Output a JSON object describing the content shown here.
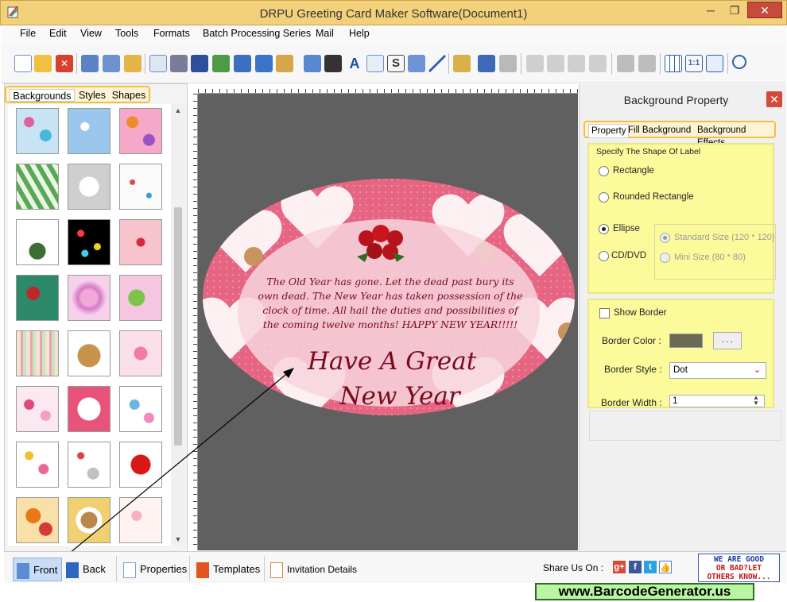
{
  "window": {
    "title": "DRPU Greeting Card Maker Software(Document1)",
    "minimize": "─",
    "restore": "❐",
    "close": "✕"
  },
  "menu": [
    "File",
    "Edit",
    "View",
    "Tools",
    "Formats",
    "Batch Processing Series",
    "Mail",
    "Help"
  ],
  "left_panel": {
    "tabs": [
      "Backgrounds",
      "Styles",
      "Shapes"
    ],
    "active_tab": "Backgrounds"
  },
  "card": {
    "message": "The Old Year has gone. Let the dead past bury its own dead. The New Year has taken possession of the clock of time. All hail the duties and possibilities of the coming twelve months! HAPPY NEW YEAR!!!!!",
    "headline_line1": "Have A Great",
    "headline_line2": "New Year"
  },
  "right_panel": {
    "title": "Background Property",
    "tabs": [
      "Property",
      "Fill Background",
      "Background Effects"
    ],
    "shape_group_label": "Specify The Shape Of Label",
    "shapes": [
      "Rectangle",
      "Rounded Rectangle",
      "Ellipse",
      "CD/DVD"
    ],
    "selected_shape": "Ellipse",
    "sizes": [
      "Standard Size (120 * 120)",
      "Mini Size (80 * 80)"
    ],
    "show_border_label": "Show Border",
    "border_color_label": "Border Color :",
    "border_color": "#6b6b55",
    "browse_label": ". . .",
    "border_style_label": "Border Style :",
    "border_style_value": "Dot",
    "border_width_label": "Border Width :",
    "border_width_value": "1"
  },
  "bottom_tabs": [
    "Front",
    "Back",
    "Properties",
    "Templates",
    "Invitation Details"
  ],
  "share_label": "Share Us On :",
  "ad": {
    "line1": "WE ARE GOOD",
    "line2": "OR BAD?LET",
    "line3": "OTHERS KNOW..."
  },
  "banner": "www.BarcodeGenerator.us"
}
